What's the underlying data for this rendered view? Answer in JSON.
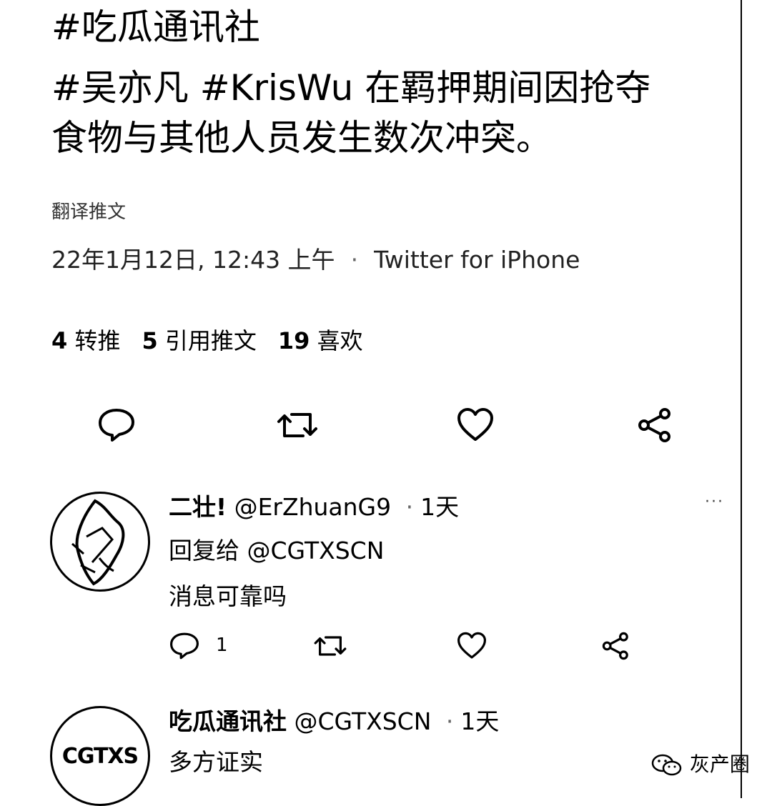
{
  "tweet": {
    "hashtag_line": "#吃瓜通讯社",
    "text_line1": "#吴亦凡 #KrisWu 在羁押期间因抢夺",
    "text_line2": "食物与其他人员发生数次冲突。",
    "translate_label": "翻译推文",
    "date": "22年1月12日, 12:43 上午",
    "source": "Twitter for iPhone",
    "stats": {
      "retweets_count": "4",
      "retweets_label": "转推",
      "quotes_count": "5",
      "quotes_label": "引用推文",
      "likes_count": "19",
      "likes_label": "喜欢"
    },
    "actions": [
      "reply-icon",
      "retweet-icon",
      "like-icon",
      "share-icon"
    ]
  },
  "replies": [
    {
      "display_name": "二壮!",
      "handle": "@ErZhuanG9",
      "time": "1天",
      "replying_to_label": "回复给",
      "replying_to_handle": "@CGTXSCN",
      "text": "消息可靠吗",
      "reply_count": "1"
    },
    {
      "display_name": "吃瓜通讯社",
      "handle": "@CGTXSCN",
      "time": "1天",
      "text": "多方证实",
      "avatar_text": "CGTXS"
    }
  ],
  "watermark": "灰产圈"
}
